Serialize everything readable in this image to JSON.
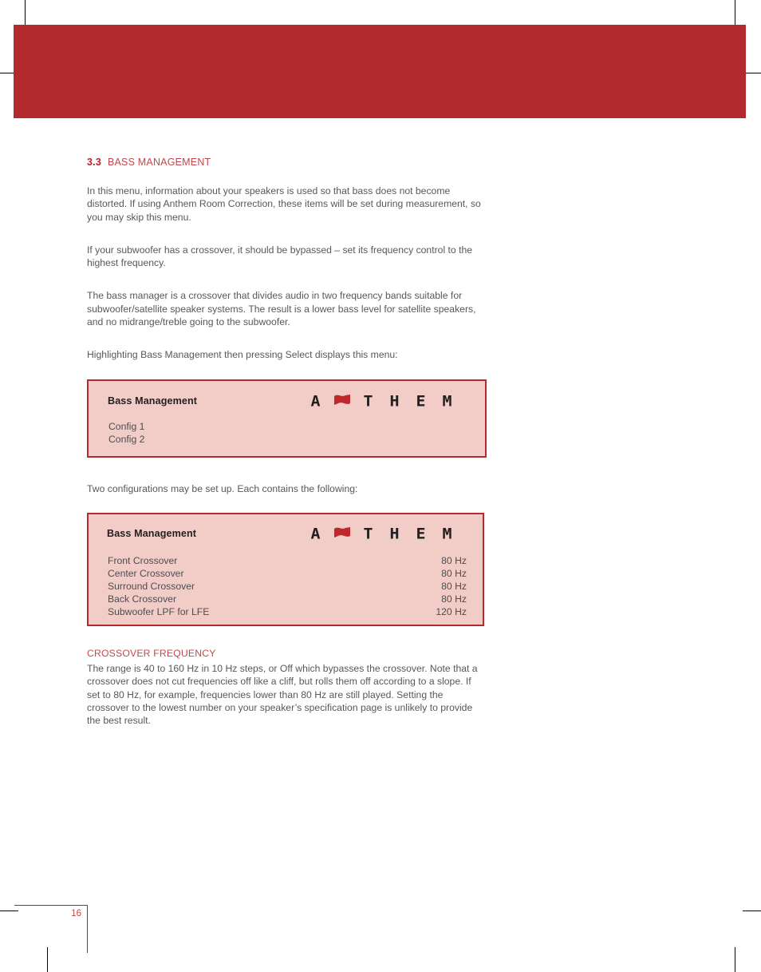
{
  "document": {
    "page_number": "16",
    "brand_logo_letters": [
      "A",
      "flag-icon",
      "T",
      "H",
      "E",
      "M"
    ],
    "brand_name": "ANTHEM"
  },
  "section": {
    "number": "3.3",
    "title": "BASS MANAGEMENT"
  },
  "paragraphs": {
    "intro": "In this menu, information about your speakers is used so that bass does not become distorted.  If using Anthem Room Correction, these items will be set during measurement, so you may skip this menu.",
    "subwoofer": "If your subwoofer has a crossover, it should be bypassed – set its frequency control to the highest frequency.",
    "bass_manager": "The bass manager is a crossover that divides audio in two frequency bands suitable for subwoofer/satellite speaker systems.  The result is a lower bass level for satellite speakers, and no midrange/treble going to the subwoofer.",
    "highlighting": "Highlighting Bass Management then pressing Select displays this menu:",
    "two_configs": "Two configurations may be set up. Each contains the following:"
  },
  "menu_box_1": {
    "title": "Bass Management",
    "items": [
      {
        "label": "Config 1"
      },
      {
        "label": "Config 2"
      }
    ]
  },
  "menu_box_2": {
    "title": "Bass Management",
    "rows": [
      {
        "label": "Front Crossover",
        "value": "80 Hz"
      },
      {
        "label": "Center Crossover",
        "value": "80 Hz"
      },
      {
        "label": "Surround Crossover",
        "value": "80 Hz"
      },
      {
        "label": "Back Crossover",
        "value": "80 Hz"
      },
      {
        "label": "Subwoofer LPF for LFE",
        "value": "120 Hz"
      }
    ]
  },
  "subsection": {
    "heading": "CROSSOVER FREQUENCY",
    "body": "The range is 40 to 160 Hz in 10 Hz steps, or Off which bypasses the crossover.  Note that a crossover does not cut frequencies off like a cliff, but rolls them off according to a slope.  If set to 80 Hz, for example, frequencies lower than 80 Hz are still played.  Setting the crossover to the lowest number on your speaker’s specification page is unlikely to provide the best result."
  },
  "colors": {
    "banner_red": "#b22a2e",
    "heading_red": "#c4474c",
    "number_red": "#b5232a",
    "box_fill": "#f2cdc8",
    "box_border": "#b52a2f",
    "body_text": "#58585b"
  }
}
